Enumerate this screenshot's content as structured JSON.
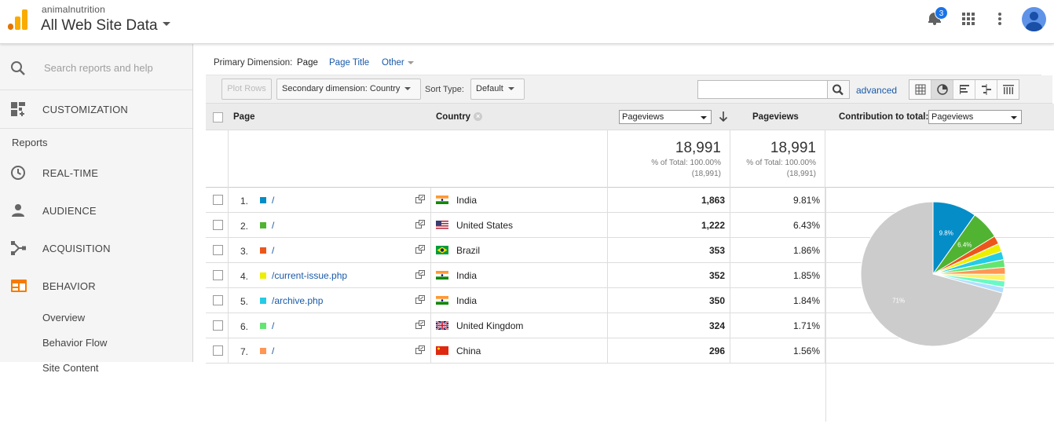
{
  "header": {
    "account": "animalnutrition",
    "property": "All Web Site Data",
    "notification_count": "3"
  },
  "sidebar": {
    "search_placeholder": "Search reports and help",
    "customization": "CUSTOMIZATION",
    "reports_label": "Reports",
    "items": [
      {
        "label": "REAL-TIME",
        "icon": "clock-icon"
      },
      {
        "label": "AUDIENCE",
        "icon": "person-icon"
      },
      {
        "label": "ACQUISITION",
        "icon": "acquisition-icon"
      },
      {
        "label": "BEHAVIOR",
        "icon": "behavior-icon",
        "active": true
      }
    ],
    "behavior_sub": [
      "Overview",
      "Behavior Flow",
      "Site Content"
    ]
  },
  "dimensions": {
    "label": "Primary Dimension:",
    "options": [
      "Page",
      "Page Title",
      "Other"
    ]
  },
  "toolbar": {
    "plot_rows": "Plot Rows",
    "secondary_dimension": "Secondary dimension: Country",
    "sort_type_label": "Sort Type:",
    "sort_type_value": "Default",
    "search_value": "",
    "advanced": "advanced"
  },
  "table": {
    "headers": {
      "page": "Page",
      "country": "Country",
      "metric_select": "Pageviews",
      "pageviews": "Pageviews",
      "contribution_label": "Contribution to total:",
      "contribution_select": "Pageviews"
    },
    "totals": {
      "value": "18,991",
      "pct_label": "% of Total: 100.00%",
      "abs": "(18,991)"
    },
    "rows": [
      {
        "num": "1.",
        "page": "/",
        "country": "India",
        "flag": "india",
        "pageviews": "1,863",
        "pct": "9.81%",
        "color": "#058dc7"
      },
      {
        "num": "2.",
        "page": "/",
        "country": "United States",
        "flag": "us",
        "pageviews": "1,222",
        "pct": "6.43%",
        "color": "#50b432"
      },
      {
        "num": "3.",
        "page": "/",
        "country": "Brazil",
        "flag": "brazil",
        "pageviews": "353",
        "pct": "1.86%",
        "color": "#ed561b"
      },
      {
        "num": "4.",
        "page": "/current-issue.php",
        "country": "India",
        "flag": "india",
        "pageviews": "352",
        "pct": "1.85%",
        "color": "#edef00"
      },
      {
        "num": "5.",
        "page": "/archive.php",
        "country": "India",
        "flag": "india",
        "pageviews": "350",
        "pct": "1.84%",
        "color": "#24cbe5"
      },
      {
        "num": "6.",
        "page": "/",
        "country": "United Kingdom",
        "flag": "uk",
        "pageviews": "324",
        "pct": "1.71%",
        "color": "#64e572"
      },
      {
        "num": "7.",
        "page": "/",
        "country": "China",
        "flag": "china",
        "pageviews": "296",
        "pct": "1.56%",
        "color": "#ff9655"
      }
    ]
  },
  "chart_data": {
    "type": "pie",
    "slices": [
      {
        "value": 9.81,
        "color": "#058dc7",
        "label": "9.8%"
      },
      {
        "value": 6.43,
        "color": "#50b432",
        "label": "6.4%"
      },
      {
        "value": 1.86,
        "color": "#ed561b"
      },
      {
        "value": 1.85,
        "color": "#edef00"
      },
      {
        "value": 1.84,
        "color": "#24cbe5"
      },
      {
        "value": 1.71,
        "color": "#64e572"
      },
      {
        "value": 1.56,
        "color": "#ff9655"
      },
      {
        "value": 1.5,
        "color": "#fff263"
      },
      {
        "value": 1.4,
        "color": "#6af9c4"
      },
      {
        "value": 1.3,
        "color": "#b2deff"
      },
      {
        "value": 70.74,
        "color": "#cccccc",
        "label": "71%"
      }
    ]
  }
}
